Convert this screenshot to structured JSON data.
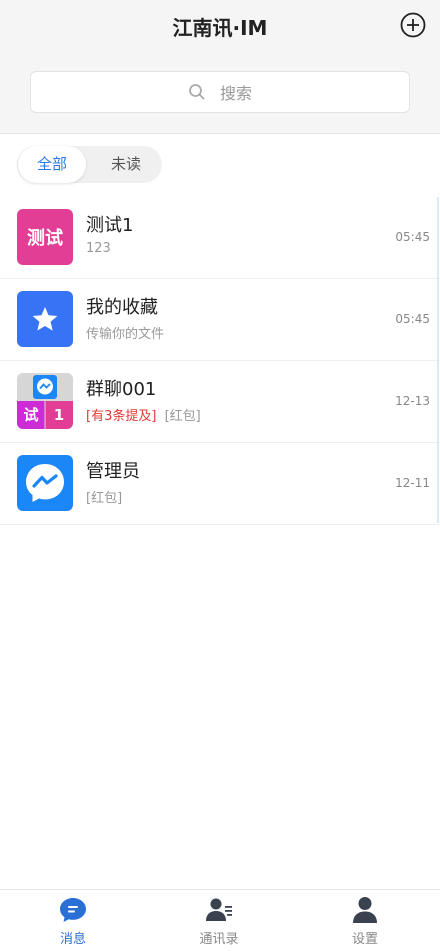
{
  "header": {
    "title": "江南讯·IM"
  },
  "search": {
    "placeholder": "搜索"
  },
  "filter_tabs": [
    {
      "label": "全部"
    },
    {
      "label": "未读"
    }
  ],
  "conversations": [
    {
      "name": "测试1",
      "preview": "123",
      "time": "05:45",
      "avatar_text": "测试",
      "avatar_color": "#e23e96"
    },
    {
      "name": "我的收藏",
      "preview": "传输你的文件",
      "time": "05:45",
      "avatar_icon": "star-icon",
      "avatar_color": "#3673f5"
    },
    {
      "name": "群聊001",
      "mention": "[有3条提及]",
      "preview": "[红包]",
      "time": "12-13",
      "avatar_tiles": [
        "试",
        "1"
      ],
      "avatar_color": "#cc2bd6"
    },
    {
      "name": "管理员",
      "preview": "[红包]",
      "time": "12-11",
      "avatar_icon": "messenger-icon",
      "avatar_color": "#1b87f7"
    }
  ],
  "bottom_nav": [
    {
      "label": "消息",
      "icon": "chat-bubble-icon",
      "active": true
    },
    {
      "label": "通讯录",
      "icon": "contacts-icon",
      "active": false
    },
    {
      "label": "设置",
      "icon": "user-icon",
      "active": false
    }
  ],
  "colors": {
    "accent": "#2a7ae2",
    "mention": "#e53935",
    "header_bg": "#f5f5f5"
  }
}
